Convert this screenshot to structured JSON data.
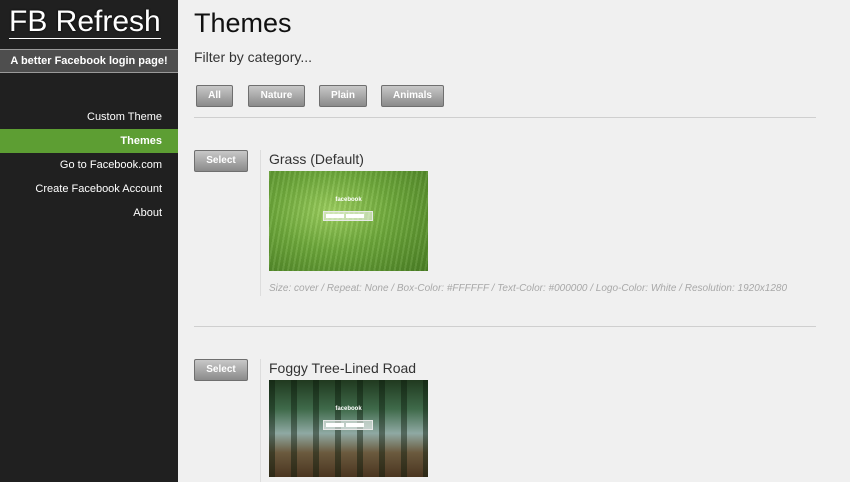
{
  "sidebar": {
    "brand_title": "FB Refresh",
    "tagline": "A better Facebook login page!",
    "nav": [
      {
        "label": "Custom Theme",
        "active": false
      },
      {
        "label": "Themes",
        "active": true
      },
      {
        "label": "Go to Facebook.com",
        "active": false
      },
      {
        "label": "Create Facebook Account",
        "active": false
      },
      {
        "label": "About",
        "active": false
      }
    ]
  },
  "main": {
    "title": "Themes",
    "filter_label": "Filter by category...",
    "filters": [
      "All",
      "Nature",
      "Plain",
      "Animals"
    ],
    "themes": [
      {
        "select_label": "Select",
        "name": "Grass (Default)",
        "thumbnail_logo": "facebook",
        "meta": "Size: cover / Repeat: None / Box-Color: #FFFFFF / Text-Color: #000000 / Logo-Color: White / Resolution: 1920x1280"
      },
      {
        "select_label": "Select",
        "name": "Foggy Tree-Lined Road",
        "thumbnail_logo": "facebook"
      }
    ]
  },
  "colors": {
    "sidebar_bg": "#202020",
    "active_nav": "#5d9e33",
    "page_bg": "#f0f0f0"
  }
}
